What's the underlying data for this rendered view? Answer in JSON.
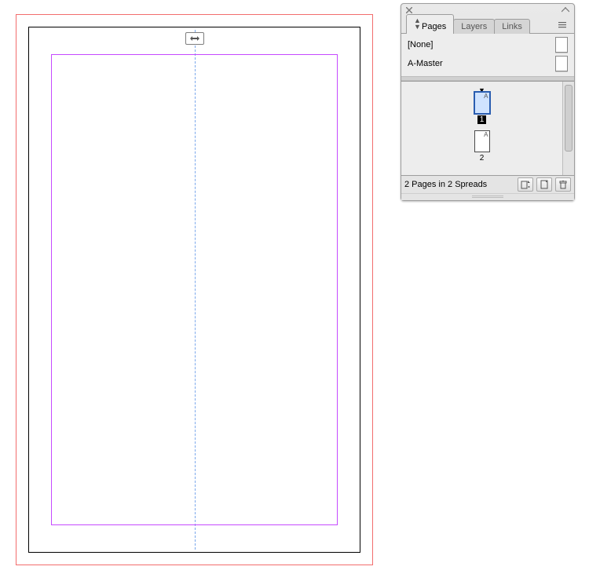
{
  "panel": {
    "tabs": {
      "pages": "Pages",
      "layers": "Layers",
      "links": "Links"
    },
    "masters": {
      "none": "[None]",
      "a_master": "A-Master"
    },
    "thumbs": {
      "page1": {
        "prefix": "A",
        "number": "1"
      },
      "page2": {
        "prefix": "A",
        "number": "2"
      }
    },
    "footer": {
      "status": "2 Pages in 2 Spreads"
    },
    "icons": {
      "close": "close-icon",
      "collapse": "collapse-icon",
      "menu": "panel-menu-icon",
      "edit_page_size": "edit-page-size-icon",
      "new_page": "new-page-icon",
      "trash": "trash-icon"
    }
  }
}
